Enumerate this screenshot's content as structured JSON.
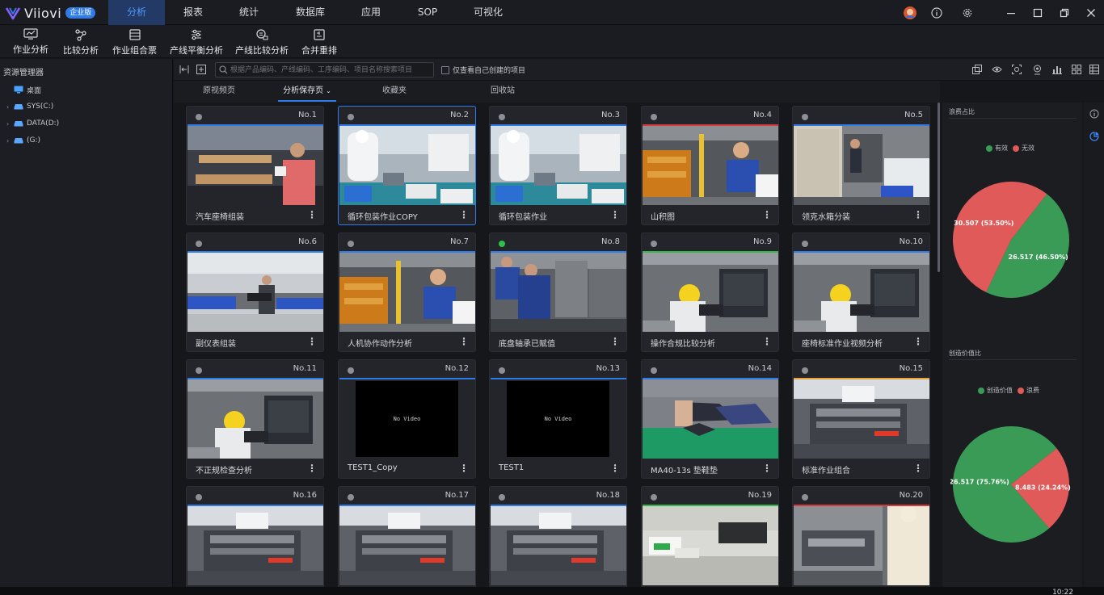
{
  "app": {
    "brand": "Viiovi",
    "edition": "企业版"
  },
  "nav": [
    "分析",
    "报表",
    "统计",
    "数据库",
    "应用",
    "SOP",
    "可视化"
  ],
  "nav_active": 0,
  "toolbar": [
    "作业分析",
    "比较分析",
    "作业组合票",
    "产线平衡分析",
    "产线比较分析",
    "合并重排"
  ],
  "sidebar": {
    "title": "资源管理器",
    "items": [
      {
        "label": "桌面",
        "icon": "desktop-icon"
      },
      {
        "label": "SYS(C:)",
        "icon": "drive-icon"
      },
      {
        "label": "DATA(D:)",
        "icon": "drive-icon"
      },
      {
        "label": "(G:)",
        "icon": "drive-icon"
      }
    ]
  },
  "filter": {
    "search_placeholder": "根据产品编码、产线编码、工序编码、项目名称搜索项目",
    "own_only": "仅查看自己创建的项目"
  },
  "tabs": [
    "原视频页",
    "分析保存页",
    "收藏夹",
    "回收站"
  ],
  "tab_active": 1,
  "cards": [
    {
      "no": "No.1",
      "name": "汽车座椅组装",
      "status": "idle",
      "top_color": "#2f7be8",
      "thumb": "t1"
    },
    {
      "no": "No.2",
      "name": "循环包装作业COPY",
      "status": "idle",
      "top_color": "#2f7be8",
      "thumb": "t2",
      "selected": true
    },
    {
      "no": "No.3",
      "name": "循环包装作业",
      "status": "idle",
      "top_color": "#2f7be8",
      "thumb": "t2"
    },
    {
      "no": "No.4",
      "name": "山积图",
      "status": "idle",
      "top_color": "#d43b3b",
      "thumb": "t4"
    },
    {
      "no": "No.5",
      "name": "领克水箱分装",
      "status": "idle",
      "top_color": "#2f7be8",
      "thumb": "t5"
    },
    {
      "no": "No.6",
      "name": "副仪表组装",
      "status": "idle",
      "top_color": "#2f7be8",
      "thumb": "t6"
    },
    {
      "no": "No.7",
      "name": "人机协作动作分析",
      "status": "idle",
      "top_color": "#2f7be8",
      "thumb": "t4"
    },
    {
      "no": "No.8",
      "name": "底盘轴承已赋值",
      "status": "ok",
      "top_color": "#2f7be8",
      "thumb": "t8"
    },
    {
      "no": "No.9",
      "name": "操作合规比较分析",
      "status": "idle",
      "top_color": "#39b54a",
      "thumb": "t9"
    },
    {
      "no": "No.10",
      "name": "座椅标准作业视频分析",
      "status": "idle",
      "top_color": "#2f7be8",
      "thumb": "t9"
    },
    {
      "no": "No.11",
      "name": "不正规检查分析",
      "status": "idle",
      "top_color": "#2f7be8",
      "thumb": "t9"
    },
    {
      "no": "No.12",
      "name": "TEST1_Copy",
      "status": "idle",
      "top_color": "#2f7be8",
      "thumb": "none"
    },
    {
      "no": "No.13",
      "name": "TEST1",
      "status": "idle",
      "top_color": "#2f7be8",
      "thumb": "none"
    },
    {
      "no": "No.14",
      "name": "MA40-13s 垫鞋垫",
      "status": "idle",
      "top_color": "#2f7be8",
      "thumb": "t14"
    },
    {
      "no": "No.15",
      "name": "标准作业组合",
      "status": "idle",
      "top_color": "#e8a23a",
      "thumb": "t15"
    },
    {
      "no": "No.16",
      "name": "",
      "status": "idle",
      "top_color": "#2f7be8",
      "thumb": "t15"
    },
    {
      "no": "No.17",
      "name": "",
      "status": "idle",
      "top_color": "#2f7be8",
      "thumb": "t15"
    },
    {
      "no": "No.18",
      "name": "",
      "status": "idle",
      "top_color": "#2f7be8",
      "thumb": "t15"
    },
    {
      "no": "No.19",
      "name": "",
      "status": "idle",
      "top_color": "#39b54a",
      "thumb": "t19"
    },
    {
      "no": "No.20",
      "name": "",
      "status": "idle",
      "top_color": "#d43b3b",
      "thumb": "t20"
    }
  ],
  "no_video_text": "No Video",
  "right": {
    "waste": {
      "title": "浪费占比",
      "legend": [
        "有效",
        "无效"
      ],
      "slices": [
        {
          "label": "26.517 (46.50%)",
          "value": 26.517,
          "color": "#3a9b57"
        },
        {
          "label": "30.507 (53.50%)",
          "value": 30.507,
          "color": "#e05a5a"
        }
      ]
    },
    "value": {
      "title": "创造价值比",
      "legend": [
        "创造价值",
        "浪费"
      ],
      "slices": [
        {
          "label": "26.517 (75.76%)",
          "value": 26.517,
          "color": "#3a9b57"
        },
        {
          "label": "8.483 (24.24%)",
          "value": 8.483,
          "color": "#e05a5a"
        }
      ]
    }
  },
  "clock": "10:22"
}
